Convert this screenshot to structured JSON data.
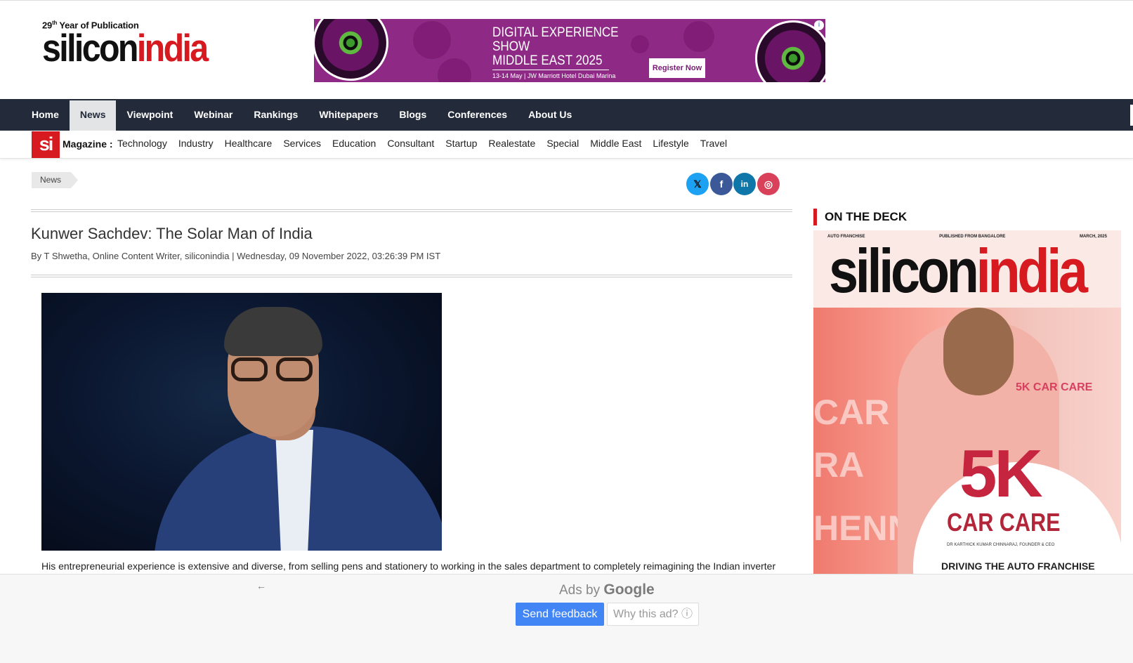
{
  "header": {
    "logo_tagline_prefix": "29",
    "logo_tagline_sup": "th",
    "logo_tagline_rest": " Year of Publication",
    "logo_part1": "silicon",
    "logo_part2": "india"
  },
  "banner_ad": {
    "title_line1": "DIGITAL EXPERIENCE",
    "title_line2": "SHOW",
    "title_line3": "MIDDLE EAST 2025",
    "subtitle": "13-14 May | JW Marriott Hotel Dubai Marina",
    "button": "Register Now",
    "info_icon": "i"
  },
  "main_nav": {
    "items": [
      {
        "label": "Home"
      },
      {
        "label": "News",
        "active": true
      },
      {
        "label": "Viewpoint"
      },
      {
        "label": "Webinar"
      },
      {
        "label": "Rankings"
      },
      {
        "label": "Whitepapers"
      },
      {
        "label": "Blogs"
      },
      {
        "label": "Conferences"
      },
      {
        "label": "About Us"
      }
    ]
  },
  "magazine_bar": {
    "badge": "si",
    "label": "Magazine :",
    "links": [
      "Technology",
      "Industry",
      "Healthcare",
      "Services",
      "Education",
      "Consultant",
      "Startup",
      "Realestate",
      "Special",
      "Middle East",
      "Lifestyle",
      "Travel"
    ]
  },
  "breadcrumb": "News",
  "social": {
    "x": "𝕏",
    "facebook": "f",
    "linkedin": "in",
    "instagram": "◎"
  },
  "article": {
    "title": "Kunwer Sachdev: The Solar Man of India",
    "byline": "By T Shwetha, Online Content Writer, siliconindia  |  Wednesday, 09 November 2022, 03:26:39 PM IST",
    "paragraph": "His entrepreneurial experience is extensive and diverse, from selling pens and stationery to working in the sales department to completely reimagining the Indian inverter"
  },
  "sidebar": {
    "deck_title": "ON THE DECK",
    "cover": {
      "masthead_part1": "silicon",
      "masthead_part2": "india",
      "brand": "5K CAR CARE",
      "headline_big": "5K",
      "headline_sub": "CAR CARE",
      "person": "DR KARTHICK KUMAR CHINNARAJ, FOUNDER & CEO",
      "tagline": "DRIVING THE AUTO FRANCHISE",
      "side_text_1": "CAR",
      "side_text_2": "RA",
      "side_text_3": "HENNAI",
      "top_left": "AUTO FRANCHISE",
      "top_mid": "PUBLISHED FROM BANGALORE",
      "top_right": "MARCH, 2025"
    }
  },
  "ad_overlay": {
    "back_arrow": "←",
    "ads_by": "Ads by",
    "google": "Google",
    "send_feedback": "Send feedback",
    "why_this_ad": "Why this ad? ⓘ"
  }
}
